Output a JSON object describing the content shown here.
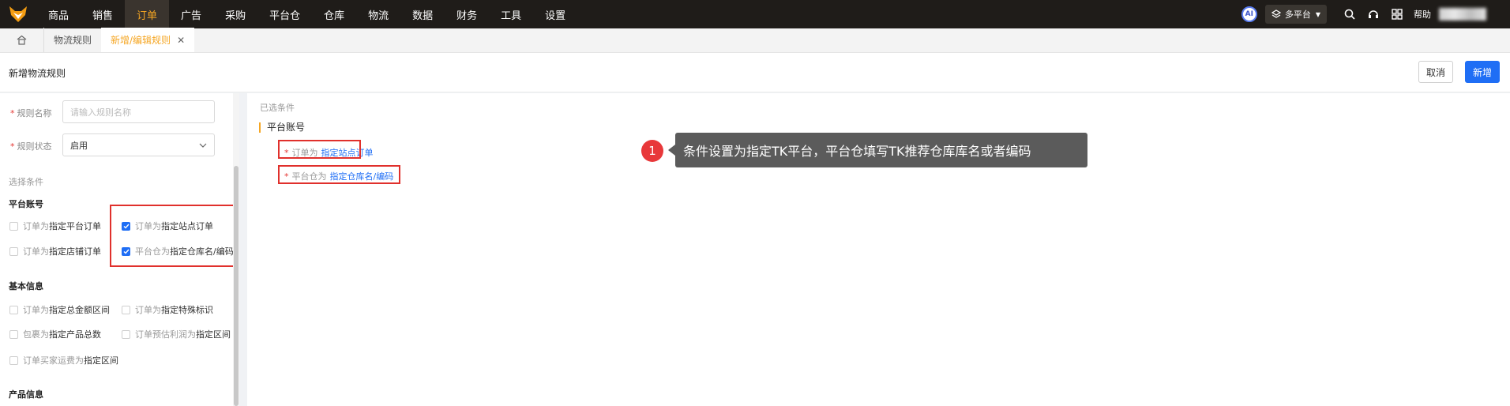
{
  "nav": {
    "items": [
      "商品",
      "销售",
      "订单",
      "广告",
      "采购",
      "平台仓",
      "仓库",
      "物流",
      "数据",
      "财务",
      "工具",
      "设置"
    ],
    "active_index": 2,
    "ai_label": "AI",
    "platform_label": "多平台",
    "help_label": "帮助"
  },
  "tabs": [
    {
      "label": "物流规则",
      "active": false
    },
    {
      "label": "新增/编辑规则",
      "active": true
    }
  ],
  "header": {
    "title": "新增物流规则",
    "cancel_label": "取消",
    "add_label": "新增"
  },
  "form": {
    "name_label": "规则名称",
    "name_placeholder": "请输入规则名称",
    "status_label": "规则状态",
    "status_value": "启用"
  },
  "conditions": {
    "hint": "选择条件",
    "groups": [
      {
        "title": "平台账号",
        "items": [
          {
            "prefix": "订单为",
            "highlight": "指定平台订单",
            "checked": false
          },
          {
            "prefix": "订单为",
            "highlight": "指定站点订单",
            "checked": true
          },
          {
            "prefix": "订单为",
            "highlight": "指定店铺订单",
            "checked": false
          },
          {
            "prefix": "平台仓为",
            "highlight": "指定仓库名/编码",
            "checked": true
          }
        ]
      },
      {
        "title": "基本信息",
        "items": [
          {
            "prefix": "订单为",
            "highlight": "指定总金额区间",
            "checked": false
          },
          {
            "prefix": "订单为",
            "highlight": "指定特殊标识",
            "checked": false
          },
          {
            "prefix": "包裹为",
            "highlight": "指定产品总数",
            "checked": false
          },
          {
            "prefix": "订单预估利润为",
            "highlight": "指定区间",
            "checked": false
          },
          {
            "prefix": "订单买家运费为",
            "highlight": "指定区间",
            "checked": false
          }
        ]
      },
      {
        "title": "产品信息",
        "items": []
      }
    ]
  },
  "selected": {
    "hint": "已选条件",
    "group_title": "平台账号",
    "items": [
      {
        "prefix": "订单为",
        "link": "指定站点订单"
      },
      {
        "prefix": "平台仓为",
        "link": "指定仓库名/编码"
      }
    ]
  },
  "annotation": {
    "step": "1",
    "text": "条件设置为指定TK平台，平台仓填写TK推荐仓库库名或者编码"
  },
  "colors": {
    "accent": "#f5a623",
    "primary": "#1f6ef5",
    "highlight_box": "#e0302c",
    "topbar": "#1f1c19"
  }
}
